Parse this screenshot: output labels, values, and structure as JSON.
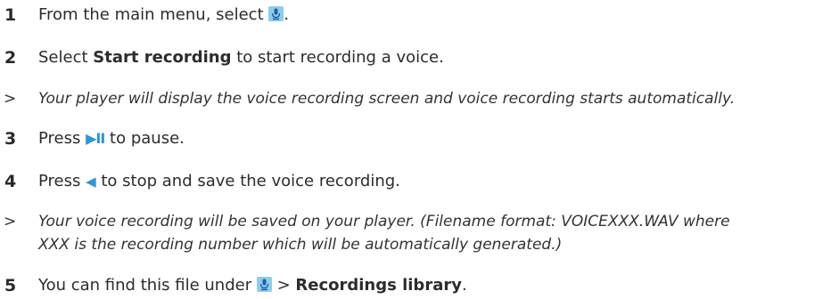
{
  "steps": [
    {
      "num": "1",
      "pre": "From the main menu, select ",
      "icon": "microphone-icon",
      "post": "."
    },
    {
      "num": "2",
      "pre": "Select ",
      "bold": "Start recording",
      "post": " to start recording a voice."
    },
    {
      "mark": ">",
      "note": "Your player will display the voice recording screen and voice recording starts automatically."
    },
    {
      "num": "3",
      "pre": "Press ",
      "icon_text": "▶II",
      "icon": "play-pause-icon",
      "post": " to pause."
    },
    {
      "num": "4",
      "pre": "Press ",
      "icon_text": "◀",
      "icon": "left-arrow-icon",
      "post": " to stop and save the voice recording."
    },
    {
      "mark": ">",
      "note_line1": "Your voice recording will be saved on your player. (Filename format: VOICEXXX.WAV where",
      "note_line2": "XXX is the recording number which will be automatically generated.)"
    },
    {
      "num": "5",
      "pre": "You can find this file under ",
      "icon": "microphone-icon",
      "mid": " > ",
      "bold": "Recordings library",
      "post": "."
    }
  ],
  "colors": {
    "accent": "#2f95d8",
    "icon_bg": "#8fcde9"
  }
}
